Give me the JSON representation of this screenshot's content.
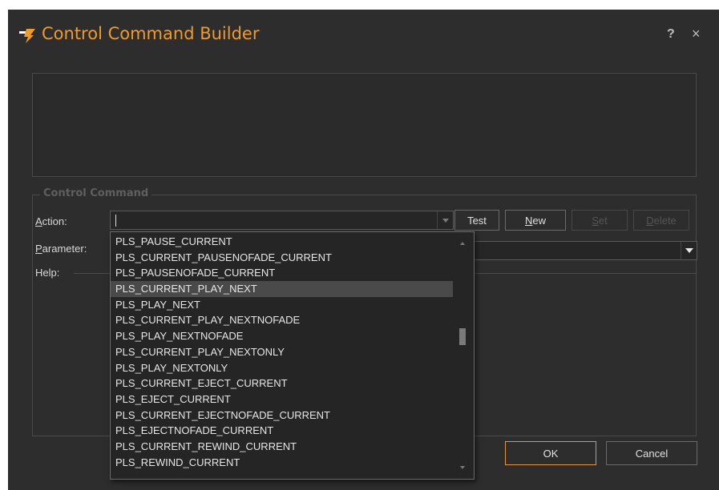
{
  "window": {
    "title": "Control Command Builder",
    "help_label": "?",
    "close_label": "×",
    "accent_color": "#f09a28"
  },
  "group": {
    "legend": "Control Command"
  },
  "labels": {
    "action_prefix": "A",
    "action_rest": "ction:",
    "parameter_prefix": "P",
    "parameter_rest": "arameter:",
    "help": "Help:"
  },
  "action_input": {
    "value": ""
  },
  "buttons": {
    "test": "Test",
    "new_prefix": "N",
    "new_rest": "ew",
    "set_prefix": "S",
    "set_rest": "et",
    "delete_prefix": "D",
    "delete_rest": "elete",
    "ok": "OK",
    "cancel": "Cancel"
  },
  "dropdown": {
    "selected_index": 3,
    "scroll_position": 0.4,
    "options": [
      "PLS_PAUSE_CURRENT",
      "PLS_CURRENT_PAUSENOFADE_CURRENT",
      "PLS_PAUSENOFADE_CURRENT",
      "PLS_CURRENT_PLAY_NEXT",
      "PLS_PLAY_NEXT",
      "PLS_CURRENT_PLAY_NEXTNOFADE",
      "PLS_PLAY_NEXTNOFADE",
      "PLS_CURRENT_PLAY_NEXTONLY",
      "PLS_PLAY_NEXTONLY",
      "PLS_CURRENT_EJECT_CURRENT",
      "PLS_EJECT_CURRENT",
      "PLS_CURRENT_EJECTNOFADE_CURRENT",
      "PLS_EJECTNOFADE_CURRENT",
      "PLS_CURRENT_REWIND_CURRENT",
      "PLS_REWIND_CURRENT"
    ]
  }
}
